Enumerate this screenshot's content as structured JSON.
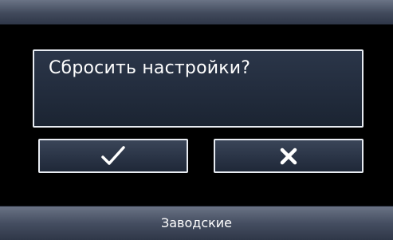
{
  "dialog": {
    "message": "Сбросить настройки?",
    "confirm_icon": "check-icon",
    "cancel_icon": "cross-icon"
  },
  "footer": {
    "label": "Заводские"
  },
  "colors": {
    "bar": "#4a5366",
    "panel": "#27303f",
    "border": "#e8ecf2",
    "text": "#ffffff"
  }
}
